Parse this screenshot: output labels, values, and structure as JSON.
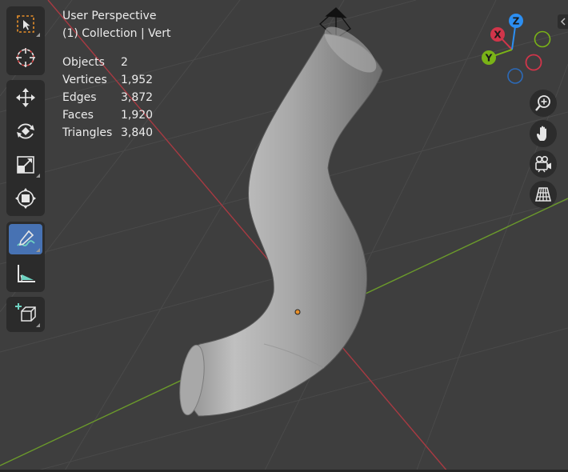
{
  "overlay": {
    "view_name": "User Perspective",
    "context": "(1) Collection | Vert",
    "stats": [
      {
        "label": "Objects",
        "value": "2"
      },
      {
        "label": "Vertices",
        "value": "1,952"
      },
      {
        "label": "Edges",
        "value": "3,872"
      },
      {
        "label": "Faces",
        "value": "1,920"
      },
      {
        "label": "Triangles",
        "value": "3,840"
      }
    ]
  },
  "toolbar": {
    "tools": [
      {
        "name": "select-box",
        "icon": "select-box-icon",
        "active": false
      },
      {
        "name": "cursor",
        "icon": "cursor-icon",
        "active": false
      },
      {
        "name": "move",
        "icon": "move-icon",
        "active": false
      },
      {
        "name": "rotate",
        "icon": "rotate-icon",
        "active": false
      },
      {
        "name": "scale",
        "icon": "scale-icon",
        "active": false
      },
      {
        "name": "transform",
        "icon": "transform-icon",
        "active": false
      },
      {
        "name": "annotate",
        "icon": "annotate-icon",
        "active": true
      },
      {
        "name": "measure",
        "icon": "measure-icon",
        "active": false
      },
      {
        "name": "add-cube",
        "icon": "add-cube-icon",
        "active": false
      }
    ]
  },
  "gizmo": {
    "x_label": "X",
    "y_label": "Y",
    "z_label": "Z",
    "x_color": "#d1354a",
    "y_color": "#7ab317",
    "z_color": "#2c8ff2"
  },
  "navigation": {
    "buttons": [
      "zoom-icon",
      "hand-pan-icon",
      "camera-icon",
      "grid-perspective-icon"
    ]
  },
  "colors": {
    "background": "#3e3e3e",
    "x_axis_line": "#a83a42",
    "y_axis_line": "#6b9a2b",
    "active_tool": "#4772b3",
    "origin_dot": "#e8902a"
  }
}
